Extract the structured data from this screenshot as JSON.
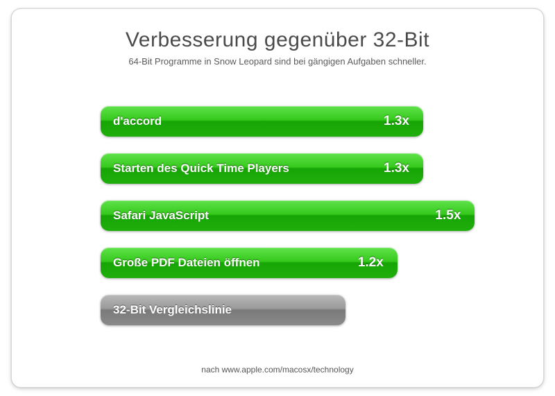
{
  "title": "Verbesserung gegenüber 32-Bit",
  "subtitle": "64-Bit Programme in Snow Leopard sind bei gängigen Aufgaben schneller.",
  "source": "nach www.apple.com/macosx/technology",
  "bars": [
    {
      "label": "d'accord",
      "value_label": "1.3x",
      "width_pct": 75,
      "color": "green"
    },
    {
      "label": "Starten des Quick Time Players",
      "value_label": "1.3x",
      "width_pct": 75,
      "color": "green"
    },
    {
      "label": "Safari JavaScript",
      "value_label": "1.5x",
      "width_pct": 87,
      "color": "green"
    },
    {
      "label": "Große PDF Dateien öffnen",
      "value_label": "1.2x",
      "width_pct": 69,
      "color": "green"
    },
    {
      "label": "32-Bit Vergleichslinie",
      "value_label": "",
      "width_pct": 57,
      "color": "gray"
    }
  ],
  "chart_data": {
    "type": "bar",
    "orientation": "horizontal",
    "title": "Verbesserung gegenüber 32-Bit",
    "subtitle": "64-Bit Programme in Snow Leopard sind bei gängigen Aufgaben schneller.",
    "xlabel": "",
    "ylabel": "",
    "baseline_label": "32-Bit Vergleichslinie",
    "baseline_value": 1.0,
    "categories": [
      "d'accord",
      "Starten des Quick Time Players",
      "Safari JavaScript",
      "Große PDF Dateien öffnen",
      "32-Bit Vergleichslinie"
    ],
    "values": [
      1.3,
      1.3,
      1.5,
      1.2,
      1.0
    ],
    "value_suffix": "x",
    "source": "nach www.apple.com/macosx/technology"
  }
}
